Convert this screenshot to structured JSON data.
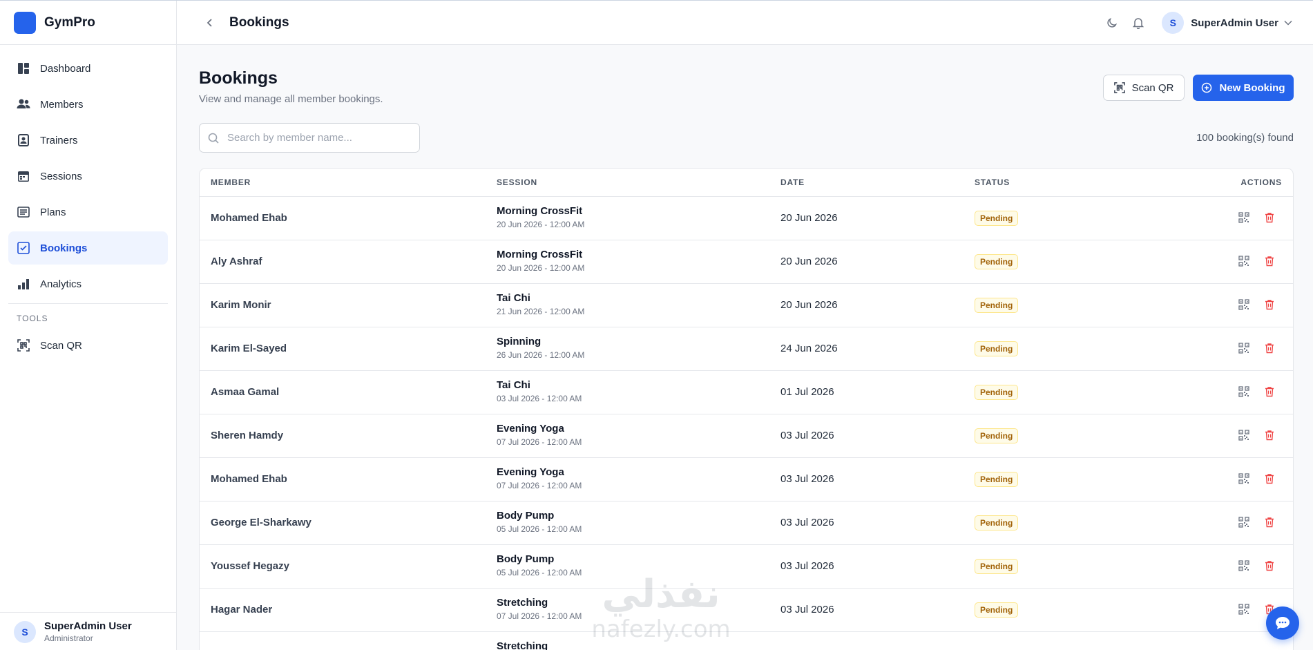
{
  "app": {
    "name": "GymPro",
    "accent": "#2563eb"
  },
  "sidebar": {
    "items": [
      {
        "label": "Dashboard",
        "icon": "dashboard-icon"
      },
      {
        "label": "Members",
        "icon": "users-icon"
      },
      {
        "label": "Trainers",
        "icon": "trainer-badge-icon"
      },
      {
        "label": "Sessions",
        "icon": "calendar-icon"
      },
      {
        "label": "Plans",
        "icon": "list-icon"
      },
      {
        "label": "Bookings",
        "icon": "checklist-icon",
        "active": true
      },
      {
        "label": "Analytics",
        "icon": "bar-chart-icon"
      }
    ],
    "tools_label": "TOOLS",
    "tools": [
      {
        "label": "Scan QR",
        "icon": "qr-scan-icon"
      }
    ],
    "footer": {
      "avatar_initial": "S",
      "name": "SuperAdmin User",
      "role": "Administrator"
    }
  },
  "topbar": {
    "title": "Bookings",
    "user": {
      "avatar_initial": "S",
      "name": "SuperAdmin User"
    }
  },
  "page": {
    "title": "Bookings",
    "subtitle": "View and manage all member bookings.",
    "scan_button": "Scan QR",
    "new_button": "New Booking",
    "search_placeholder": "Search by member name...",
    "count_text": "100 booking(s) found"
  },
  "table": {
    "headers": {
      "member": "MEMBER",
      "session": "SESSION",
      "date": "DATE",
      "status": "STATUS",
      "actions": "ACTIONS"
    },
    "rows": [
      {
        "member": "Mohamed Ehab",
        "session": "Morning CrossFit",
        "session_time": "20 Jun 2026 - 12:00 AM",
        "date": "20 Jun 2026",
        "status": "Pending"
      },
      {
        "member": "Aly Ashraf",
        "session": "Morning CrossFit",
        "session_time": "20 Jun 2026 - 12:00 AM",
        "date": "20 Jun 2026",
        "status": "Pending"
      },
      {
        "member": "Karim Monir",
        "session": "Tai Chi",
        "session_time": "21 Jun 2026 - 12:00 AM",
        "date": "20 Jun 2026",
        "status": "Pending"
      },
      {
        "member": "Karim El-Sayed",
        "session": "Spinning",
        "session_time": "26 Jun 2026 - 12:00 AM",
        "date": "24 Jun 2026",
        "status": "Pending"
      },
      {
        "member": "Asmaa Gamal",
        "session": "Tai Chi",
        "session_time": "03 Jul 2026 - 12:00 AM",
        "date": "01 Jul 2026",
        "status": "Pending"
      },
      {
        "member": "Sheren Hamdy",
        "session": "Evening Yoga",
        "session_time": "07 Jul 2026 - 12:00 AM",
        "date": "03 Jul 2026",
        "status": "Pending"
      },
      {
        "member": "Mohamed Ehab",
        "session": "Evening Yoga",
        "session_time": "07 Jul 2026 - 12:00 AM",
        "date": "03 Jul 2026",
        "status": "Pending"
      },
      {
        "member": "George El-Sharkawy",
        "session": "Body Pump",
        "session_time": "05 Jul 2026 - 12:00 AM",
        "date": "03 Jul 2026",
        "status": "Pending"
      },
      {
        "member": "Youssef Hegazy",
        "session": "Body Pump",
        "session_time": "05 Jul 2026 - 12:00 AM",
        "date": "03 Jul 2026",
        "status": "Pending"
      },
      {
        "member": "Hagar Nader",
        "session": "Stretching",
        "session_time": "07 Jul 2026 - 12:00 AM",
        "date": "03 Jul 2026",
        "status": "Pending"
      },
      {
        "member": "",
        "session": "Stretching",
        "session_time": "",
        "date": "",
        "status": ""
      }
    ]
  },
  "watermark": {
    "line1": "نفذلي",
    "line2": "nafezly.com"
  }
}
